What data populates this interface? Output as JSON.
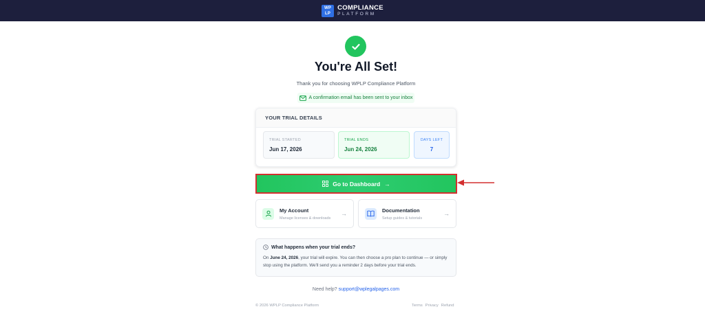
{
  "header": {
    "logo_mark_top": "WP",
    "logo_mark_bottom": "LP",
    "brand_line1": "COMPLIANCE",
    "brand_line2": "PLATFORM",
    "background": "#1d1f3d"
  },
  "hero": {
    "icon": "check-icon",
    "title": "You're All Set!",
    "subtitle": "Thank you for choosing WPLP Compliance Platform",
    "confirmation": "A confirmation email has been sent to your inbox"
  },
  "trial": {
    "heading": "YOUR TRIAL DETAILS",
    "started_label": "TRIAL STARTED",
    "started_value": "Jun 17, 2026",
    "ends_label": "TRIAL ENDS",
    "ends_value": "Jun 24, 2026",
    "days_label": "DAYS LEFT",
    "days_value": "7"
  },
  "cta": {
    "label": "Go to Dashboard",
    "arrow": "→",
    "color": "#22c55e"
  },
  "links": [
    {
      "title": "My Account",
      "subtitle": "Manage licenses & downloads",
      "arrow": "→"
    },
    {
      "title": "Documentation",
      "subtitle": "Setup guides & tutorials",
      "arrow": "→"
    }
  ],
  "info": {
    "heading": "What happens when your trial ends?",
    "body_prefix": "On ",
    "body_date": "June 24, 2026",
    "body_suffix": ", your trial will expire. You can then choose a pro plan to continue — or simply stop using the platform. We'll send you a reminder 2 days before your trial ends."
  },
  "help": {
    "prefix": "Need help?",
    "email": "support@wplegalpages.com"
  },
  "footer": {
    "copyright": "© 2026 WPLP Compliance Platform",
    "terms": "Terms",
    "privacy": "Privacy",
    "refund": "Refund"
  }
}
